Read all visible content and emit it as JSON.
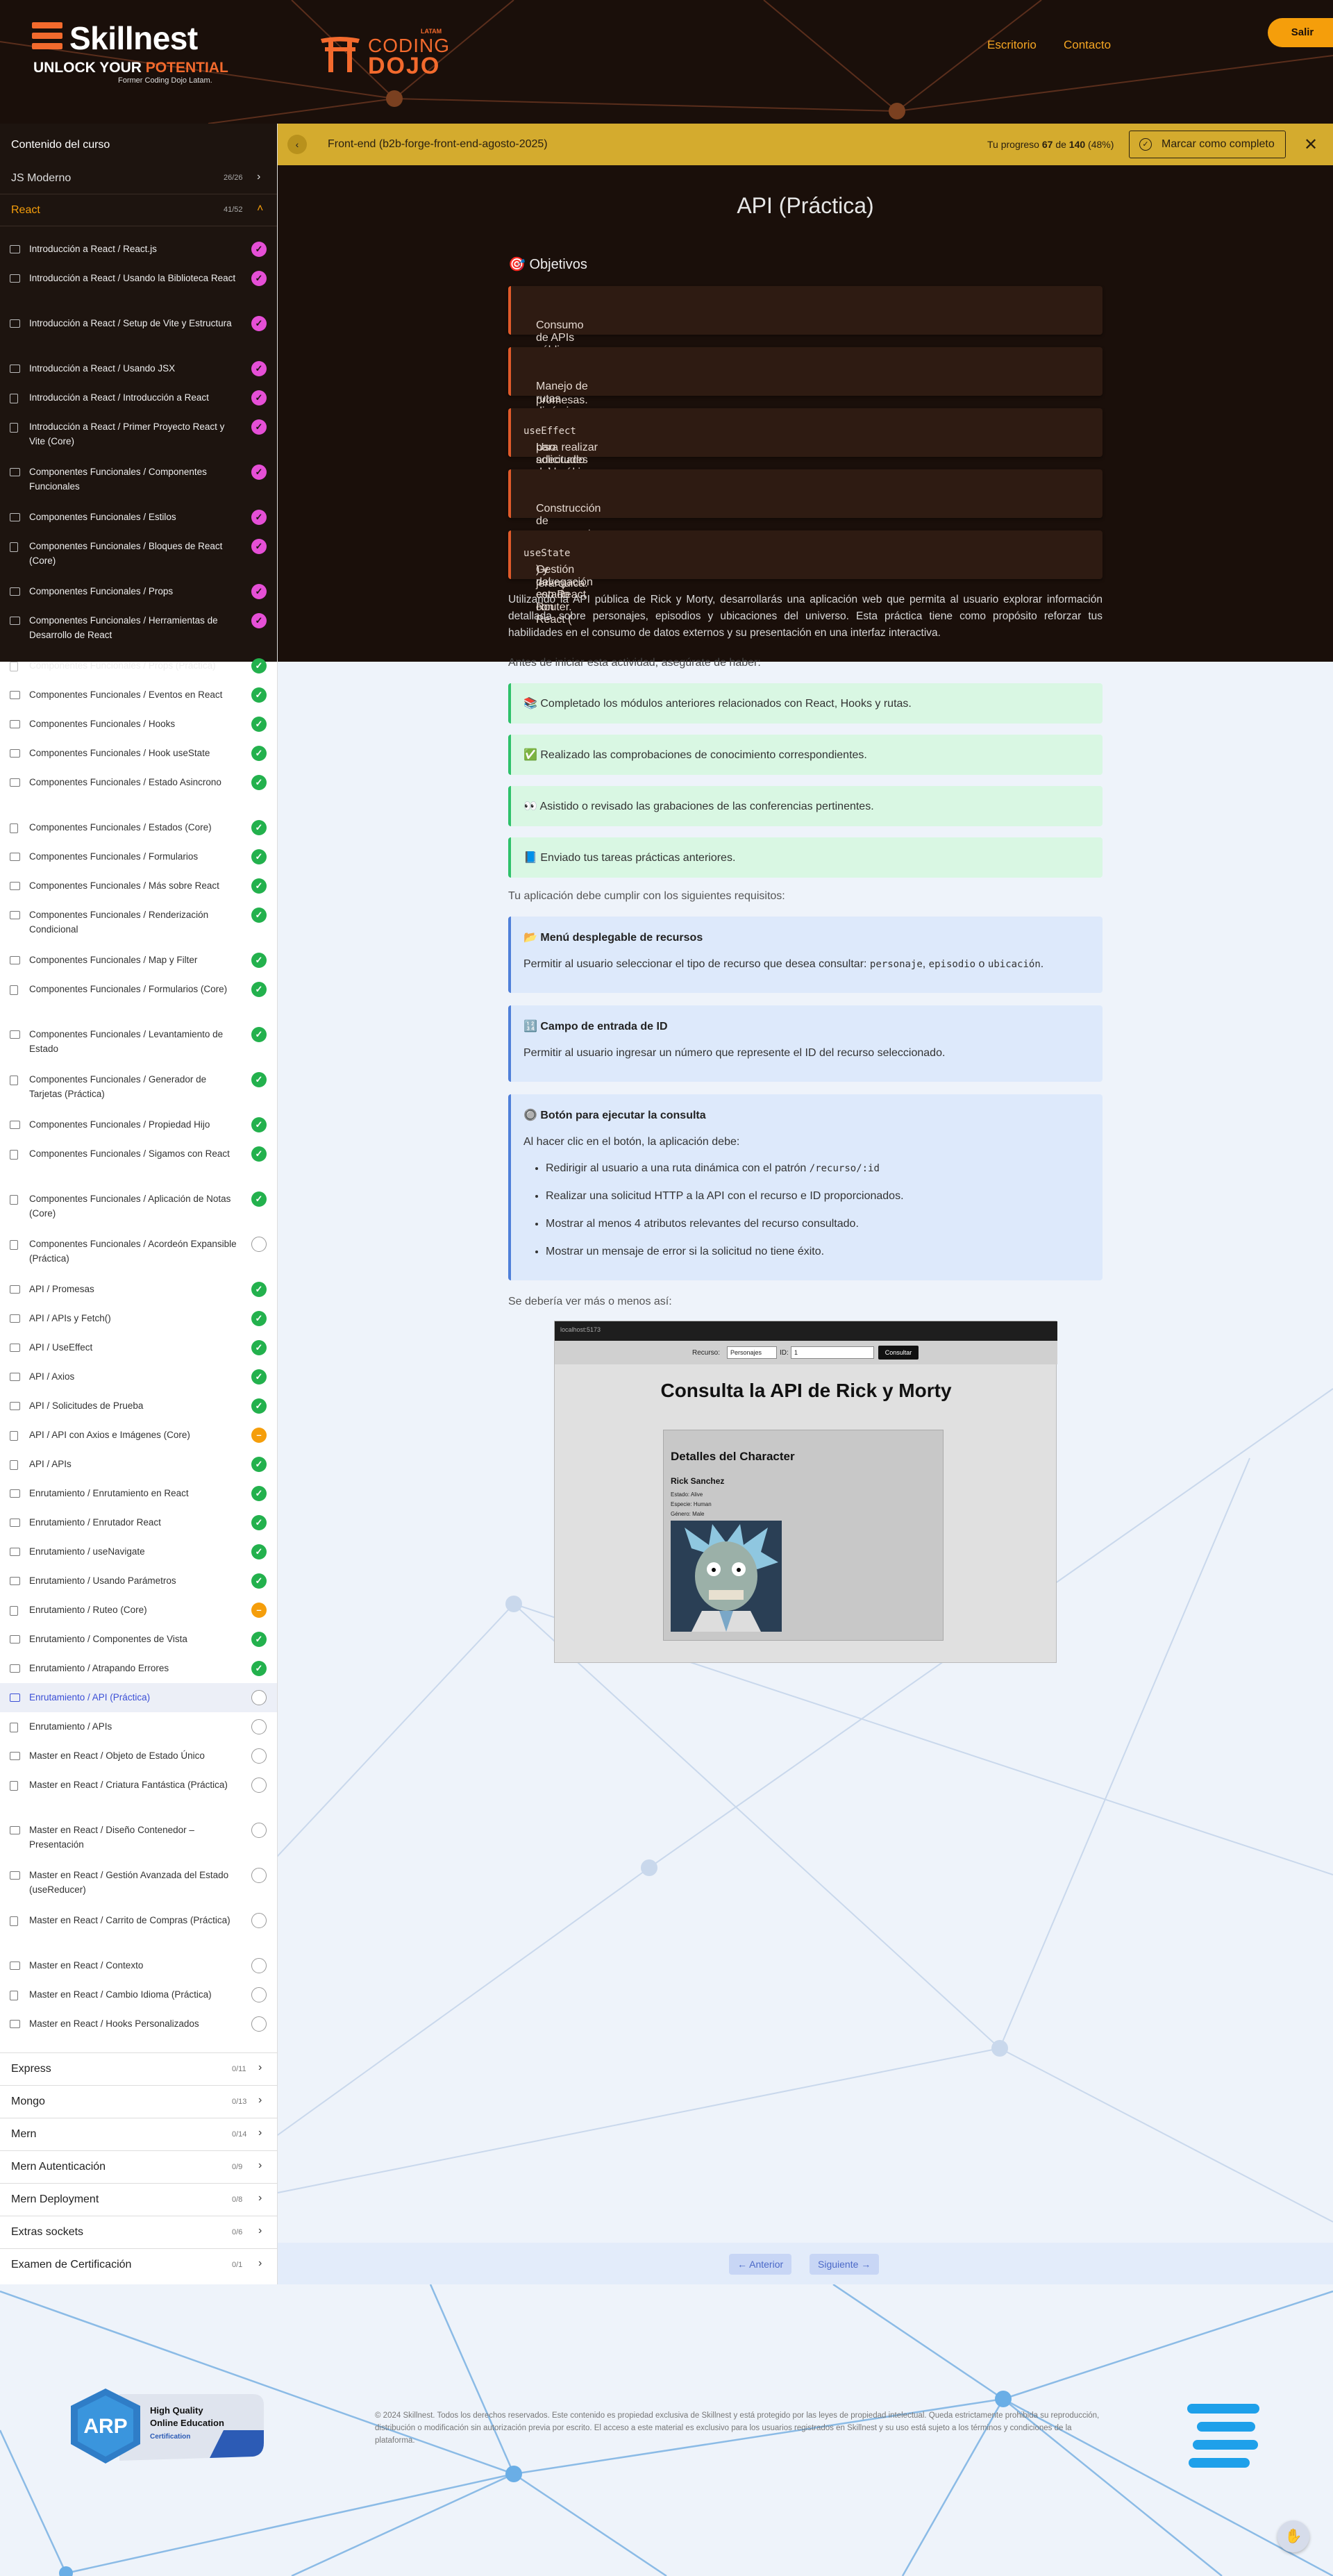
{
  "header": {
    "brand": "Skillnest",
    "tagline_a": "UNLOCK YOUR ",
    "tagline_b": "POTENTIAL",
    "subtitle": "Former Coding Dojo Latam.",
    "partner_top": "LATAM",
    "partner_a": "CODING",
    "partner_b": "DOJO",
    "nav": [
      "Escritorio",
      "Contacto"
    ],
    "logout": "Salir"
  },
  "sidebar": {
    "title": "Contenido del curso",
    "open_sections": [
      {
        "name": "JS Moderno",
        "count": "26/26"
      },
      {
        "name": "React",
        "count": "41/52"
      }
    ],
    "lessons": [
      {
        "t": "Introducción a React / React.js",
        "s": "pink",
        "i": "video"
      },
      {
        "t": "Introducción a React / Usando la Biblioteca React",
        "s": "pink",
        "i": "video"
      },
      {
        "t": "Introducción a React / Setup de Vite y Estructura",
        "s": "pink",
        "i": "video"
      },
      {
        "t": "Introducción a React / Usando JSX",
        "s": "pink",
        "i": "video"
      },
      {
        "t": "Introducción a React / Introducción a React",
        "s": "pink",
        "i": "doc"
      },
      {
        "t": "Introducción a React / Primer Proyecto React y Vite (Core)",
        "s": "pink",
        "i": "doc"
      },
      {
        "t": "Componentes Funcionales / Componentes Funcionales",
        "s": "pink",
        "i": "video"
      },
      {
        "t": "Componentes Funcionales / Estilos",
        "s": "pink",
        "i": "video"
      },
      {
        "t": "Componentes Funcionales / Bloques de React (Core)",
        "s": "pink",
        "i": "doc"
      },
      {
        "t": "Componentes Funcionales / Props",
        "s": "pink",
        "i": "video"
      },
      {
        "t": "Componentes Funcionales / Herramientas de Desarrollo de React",
        "s": "pink",
        "i": "video"
      },
      {
        "t": "Componentes Funcionales / Props (Práctica)",
        "s": "green",
        "i": "doc"
      },
      {
        "t": "Componentes Funcionales / Eventos en React",
        "s": "green",
        "i": "video"
      },
      {
        "t": "Componentes Funcionales / Hooks",
        "s": "green",
        "i": "video"
      },
      {
        "t": "Componentes Funcionales / Hook useState",
        "s": "green",
        "i": "video"
      },
      {
        "t": "Componentes Funcionales / Estado Asincrono",
        "s": "green",
        "i": "video"
      },
      {
        "t": "Componentes Funcionales / Estados (Core)",
        "s": "green",
        "i": "doc"
      },
      {
        "t": "Componentes Funcionales / Formularios",
        "s": "green",
        "i": "video"
      },
      {
        "t": "Componentes Funcionales / Más sobre React",
        "s": "green",
        "i": "video"
      },
      {
        "t": "Componentes Funcionales / Renderización Condicional",
        "s": "green",
        "i": "video"
      },
      {
        "t": "Componentes Funcionales / Map y Filter",
        "s": "green",
        "i": "video"
      },
      {
        "t": "Componentes Funcionales / Formularios (Core)",
        "s": "green",
        "i": "doc"
      },
      {
        "t": "Componentes Funcionales / Levantamiento de Estado",
        "s": "green",
        "i": "video"
      },
      {
        "t": "Componentes Funcionales / Generador de Tarjetas (Práctica)",
        "s": "green",
        "i": "doc"
      },
      {
        "t": "Componentes Funcionales / Propiedad Hijo",
        "s": "green",
        "i": "video"
      },
      {
        "t": "Componentes Funcionales / Sigamos con React",
        "s": "green",
        "i": "doc"
      },
      {
        "t": "Componentes Funcionales / Aplicación de Notas (Core)",
        "s": "green",
        "i": "doc"
      },
      {
        "t": "Componentes Funcionales / Acordeón Expansible (Práctica)",
        "s": "empty",
        "i": "doc"
      },
      {
        "t": "API / Promesas",
        "s": "green",
        "i": "video"
      },
      {
        "t": "API / APIs y Fetch()",
        "s": "green",
        "i": "video"
      },
      {
        "t": "API / UseEffect",
        "s": "green",
        "i": "video"
      },
      {
        "t": "API / Axios",
        "s": "green",
        "i": "video"
      },
      {
        "t": "API / Solicitudes de Prueba",
        "s": "green",
        "i": "video"
      },
      {
        "t": "API / API con Axios e Imágenes (Core)",
        "s": "orange",
        "i": "doc"
      },
      {
        "t": "API / APIs",
        "s": "green",
        "i": "doc"
      },
      {
        "t": "Enrutamiento / Enrutamiento en React",
        "s": "green",
        "i": "video"
      },
      {
        "t": "Enrutamiento / Enrutador React",
        "s": "green",
        "i": "video"
      },
      {
        "t": "Enrutamiento / useNavigate",
        "s": "green",
        "i": "video"
      },
      {
        "t": "Enrutamiento / Usando Parámetros",
        "s": "green",
        "i": "video"
      },
      {
        "t": "Enrutamiento / Ruteo (Core)",
        "s": "orange",
        "i": "doc"
      },
      {
        "t": "Enrutamiento / Componentes de Vista",
        "s": "green",
        "i": "video"
      },
      {
        "t": "Enrutamiento / Atrapando Errores",
        "s": "green",
        "i": "video"
      },
      {
        "t": "Enrutamiento / API (Práctica)",
        "s": "empty",
        "i": "video",
        "active": true
      },
      {
        "t": "Enrutamiento / APIs",
        "s": "empty",
        "i": "doc"
      },
      {
        "t": "Master en React / Objeto de Estado Único",
        "s": "empty",
        "i": "video"
      },
      {
        "t": "Master en React / Criatura Fantástica (Práctica)",
        "s": "empty",
        "i": "doc"
      },
      {
        "t": "Master en React / Diseño Contenedor – Presentación",
        "s": "empty",
        "i": "video"
      },
      {
        "t": "Master en React / Gestión Avanzada del Estado (useReducer)",
        "s": "empty",
        "i": "video"
      },
      {
        "t": "Master en React / Carrito de Compras (Práctica)",
        "s": "empty",
        "i": "doc"
      },
      {
        "t": "Master en React / Contexto",
        "s": "empty",
        "i": "video"
      },
      {
        "t": "Master en React / Cambio Idioma (Práctica)",
        "s": "empty",
        "i": "doc"
      },
      {
        "t": "Master en React / Hooks Personalizados",
        "s": "empty",
        "i": "video"
      }
    ],
    "collapsed_sections": [
      {
        "name": "Express",
        "count": "0/11"
      },
      {
        "name": "Mongo",
        "count": "0/13"
      },
      {
        "name": "Mern",
        "count": "0/14"
      },
      {
        "name": "Mern Autenticación",
        "count": "0/9"
      },
      {
        "name": "Mern Deployment",
        "count": "0/8"
      },
      {
        "name": "Extras sockets",
        "count": "0/6"
      },
      {
        "name": "Examen de Certificación",
        "count": "0/1"
      }
    ]
  },
  "progress_bar": {
    "course": "Front-end (b2b-forge-front-end-agosto-2025)",
    "label_pre": "Tu progreso ",
    "done": "67",
    "label_mid": " de ",
    "total": "140",
    "percent_text": " (48%)",
    "percent": 48,
    "mark_complete": "Marcar como completo"
  },
  "lesson": {
    "title": "API (Práctica)",
    "objectives_title": "🎯 Objetivos",
    "objectives": [
      [
        "Consumo de APIs públicas utilizando fetch y manejo de promesas."
      ],
      [
        "Manejo de rutas dinámicas con parámetros."
      ],
      [
        "Uso adecuado del hook ",
        "useEffect",
        " para realizar solicitudes asincrónicas en React."
      ],
      [
        "Construcción de componentes funcionales con estructura jerárquica."
      ],
      [
        "Gestión del estado con React (",
        "useState",
        ") y navegación con React Router."
      ]
    ],
    "intro": "Utilizando la API pública de Rick y Morty, desarrollarás una aplicación web que permita al usuario explorar información detallada sobre personajes, episodios y ubicaciones del universo. Esta práctica tiene como propósito reforzar tus habilidades en el consumo de datos externos y su presentación en una interfaz interactiva.",
    "prereq_title": "Antes de iniciar esta actividad, asegúrate de haber:",
    "prereqs": [
      "📚 Completado los módulos anteriores relacionados con React, Hooks y rutas.",
      "✅ Realizado las comprobaciones de conocimiento correspondientes.",
      "👀 Asistido o revisado las grabaciones de las conferencias pertinentes.",
      "📘 Enviado tus tareas prácticas anteriores."
    ],
    "req_title": "Tu aplicación debe cumplir con los siguientes requisitos:",
    "req1_title": "📂 Menú desplegable de recursos",
    "req1_a": "Permitir al usuario seleccionar el tipo de recurso que desea consultar: ",
    "req1_c1": "personaje",
    "req1_sep1": ", ",
    "req1_c2": "episodio",
    "req1_sep2": " o ",
    "req1_c3": "ubicación",
    "req1_end": ".",
    "req2_title": "🔢 Campo de entrada de ID",
    "req2_desc": "Permitir al usuario ingresar un número que represente el ID del recurso seleccionado.",
    "req3_title": "🔘 Botón para ejecutar la consulta",
    "req3_desc": "Al hacer clic en el botón, la aplicación debe:",
    "req3_b1_a": "Redirigir al usuario a una ruta dinámica con el patrón ",
    "req3_b1_code": "/recurso/:id",
    "req3_bullets": [
      "Realizar una solicitud HTTP a la API con el recurso e ID proporcionados.",
      "Mostrar al menos 4 atributos relevantes del recurso consultado.",
      "Mostrar un mensaje de error si la solicitud no tiene éxito."
    ],
    "see_text": "Se debería ver más o menos así:",
    "demo": {
      "url": "localhost:5173",
      "label_res": "Recurso:",
      "select": "Personajes",
      "label_id": "ID:",
      "id_value": "1",
      "button": "Consultar",
      "heading": "Consulta la API de Rick y Morty",
      "card_title": "Detalles del Character",
      "name": "Rick Sanchez",
      "info": [
        "Estado: Alive",
        "Especie: Human",
        "Género: Male"
      ]
    }
  },
  "pager": {
    "prev": "← Anterior",
    "next": "Siguiente →"
  },
  "footer": {
    "badge_a": "ARP",
    "badge_b": "High Quality",
    "badge_c": "Online Education",
    "badge_d": "Certification",
    "copyright": "© 2024 Skillnest. Todos los derechos reservados. Este contenido es propiedad exclusiva de Skillnest y está protegido por las leyes de propiedad intelectual. Queda estrictamente prohibida su reproducción, distribución o modificación sin autorización previa por escrito. El acceso a este material es exclusivo para los usuarios registrados en Skillnest y su uso está sujeto a los términos y condiciones de la plataforma."
  },
  "colors": {
    "accent": "#f36a2d",
    "banner": "#d4ab2e",
    "done": "#23b14d",
    "active": "#3b4fd6"
  }
}
